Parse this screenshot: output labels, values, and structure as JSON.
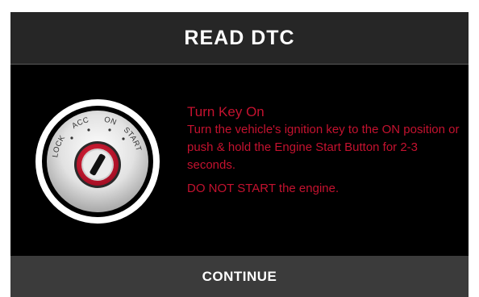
{
  "dialog": {
    "title": "READ DTC",
    "instruction": {
      "title": "Turn Key On",
      "description": "Turn the vehicle's ignition key to the ON position or push & hold the Engine Start Button for 2-3 seconds.",
      "warning": "DO NOT START the engine."
    },
    "ignition_labels": {
      "lock": "LOCK",
      "acc": "ACC",
      "on": "ON",
      "start": "START"
    },
    "continue_label": "CONTINUE"
  },
  "colors": {
    "accent_red": "#c4122f",
    "header_bg": "#262626",
    "footer_bg": "#3b3b3b",
    "body_bg": "#000000"
  },
  "icons": {
    "ignition": "ignition-key-icon"
  }
}
